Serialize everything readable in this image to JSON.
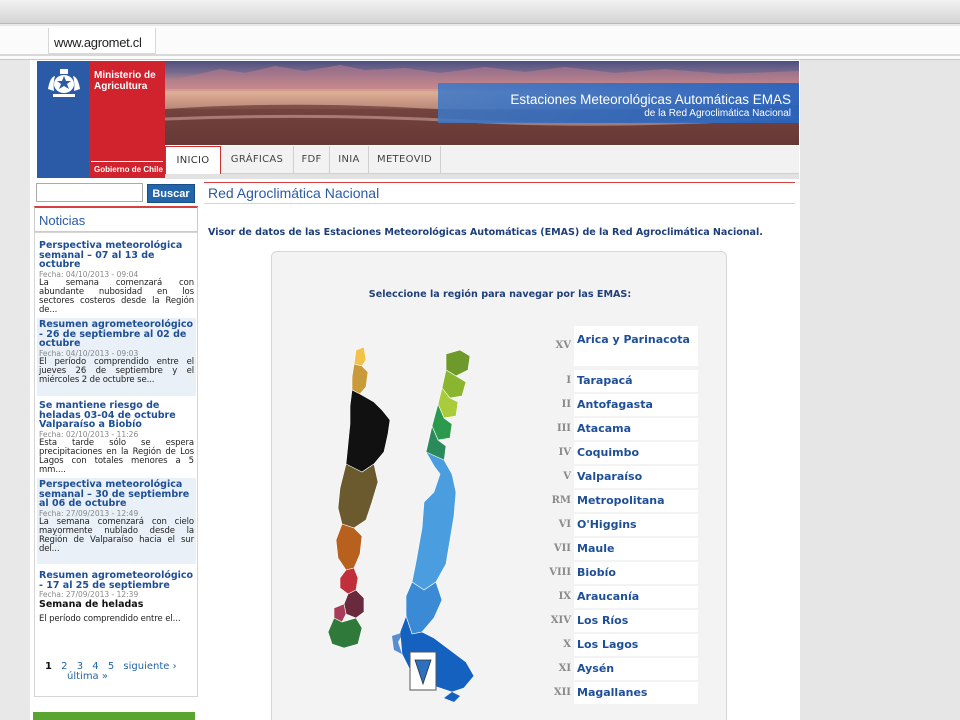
{
  "browser": {
    "url": "www.agromet.cl"
  },
  "header": {
    "ministry_line1": "Ministerio de",
    "ministry_line2": "Agricultura",
    "gobierno": "Gobierno de Chile",
    "banner_title": "Estaciones Meteorológicas Automáticas EMAS",
    "banner_subtitle": "de la Red Agroclimática Nacional"
  },
  "nav": {
    "items": [
      {
        "label": "INICIO",
        "active": true
      },
      {
        "label": "GRÁFICAS",
        "active": false
      },
      {
        "label": "FDF",
        "active": false
      },
      {
        "label": "INIA",
        "active": false
      },
      {
        "label": "METEOVID",
        "active": false
      }
    ]
  },
  "search": {
    "value": "",
    "button_label": "Buscar"
  },
  "news": {
    "title": "Noticias",
    "items": [
      {
        "title": "Perspectiva meteorológica semanal – 07 al 13 de octubre",
        "date": "Fecha: 04/10/2013 - 09:04",
        "body": "La semana comenzará con abundante nubosidad en los sectores costeros desde la Región de..."
      },
      {
        "title": "Resumen agrometeorológico - 26 de septiembre al 02 de octubre",
        "date": "Fecha: 04/10/2013 - 09:03",
        "body": "El período comprendido entre el jueves 26 de septiembre y el miércoles 2 de octubre se..."
      },
      {
        "title": "Se mantiene riesgo de heladas 03-04 de octubre Valparaíso a Biobío",
        "date": "Fecha: 02/10/2013 - 11:26",
        "body": "Esta tarde sólo se espera precipitaciones en la Región de Los Lagos con totales menores a 5 mm...."
      },
      {
        "title": "Perspectiva meteorológica semanal – 30 de septiembre al 06 de octubre",
        "date": "Fecha: 27/09/2013 - 12:49",
        "body": "La semana comenzará con cielo mayormente nublado desde la Región de Valparaíso hacia el sur del..."
      },
      {
        "title": "Resumen agrometeorológico - 17 al 25 de septiembre",
        "date": "Fecha: 27/09/2013 - 12:39",
        "subtitle": "Semana de heladas",
        "body": "El período comprendido entre el..."
      }
    ],
    "pager": {
      "pages": [
        "1",
        "2",
        "3",
        "4",
        "5"
      ],
      "current": "1",
      "next_label": "siguiente ›",
      "last_label": "última »"
    }
  },
  "content": {
    "title": "Red Agroclimática Nacional",
    "intro": "Visor de datos de las Estaciones Meteorológicas Automáticas (EMAS) de la Red Agroclimática Nacional.",
    "prompt": "Seleccione la región para navegar por las EMAS:",
    "regions": [
      {
        "num": "XV",
        "name": "Arica y Parinacota"
      },
      {
        "num": "I",
        "name": "Tarapacá"
      },
      {
        "num": "II",
        "name": "Antofagasta"
      },
      {
        "num": "III",
        "name": "Atacama"
      },
      {
        "num": "IV",
        "name": "Coquimbo"
      },
      {
        "num": "V",
        "name": "Valparaíso"
      },
      {
        "num": "RM",
        "name": "Metropolitana"
      },
      {
        "num": "VI",
        "name": "O'Higgins"
      },
      {
        "num": "VII",
        "name": "Maule"
      },
      {
        "num": "VIII",
        "name": "Biobío"
      },
      {
        "num": "IX",
        "name": "Araucanía"
      },
      {
        "num": "XIV",
        "name": "Los Ríos"
      },
      {
        "num": "X",
        "name": "Los Lagos"
      },
      {
        "num": "XI",
        "name": "Aysén"
      },
      {
        "num": "XII",
        "name": "Magallanes"
      }
    ]
  },
  "colors": {
    "ministry_red": "#d0232e",
    "ministry_blue": "#2b5aa6",
    "link_blue": "#1e4f96",
    "button_blue": "#2464a8",
    "green_bar": "#5aa531"
  }
}
